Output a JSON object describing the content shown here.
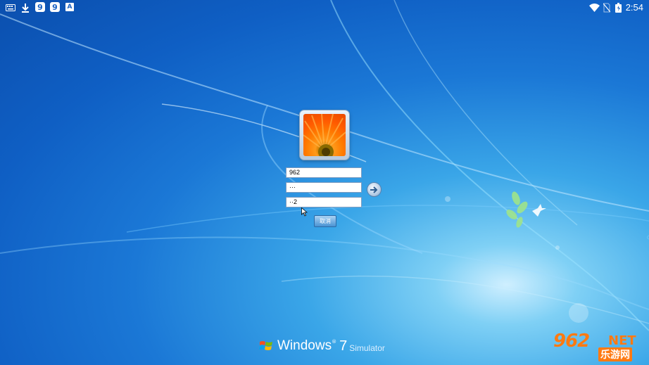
{
  "statusbar": {
    "left_icons": [
      "keyboard-icon",
      "download-icon",
      "app-9-icon",
      "app-9-icon",
      "text-a-icon"
    ],
    "app_icon_text": "9",
    "a_icon_text": "A",
    "right_icons": [
      "wifi-icon",
      "no-sim-icon",
      "battery-icon"
    ],
    "time": "2:54"
  },
  "login": {
    "username": "962",
    "password": "···",
    "captcha": "··2",
    "cancel_label": "取消"
  },
  "brand": {
    "name": "Windows",
    "reg": "®",
    "version": "7",
    "suffix": "Simulator"
  },
  "watermark": {
    "number": "962",
    "net": "NET",
    "chinese": "乐游网"
  },
  "colors": {
    "wallpaper_blue": "#1b78d6",
    "watermark_orange": "#ff7a12"
  }
}
